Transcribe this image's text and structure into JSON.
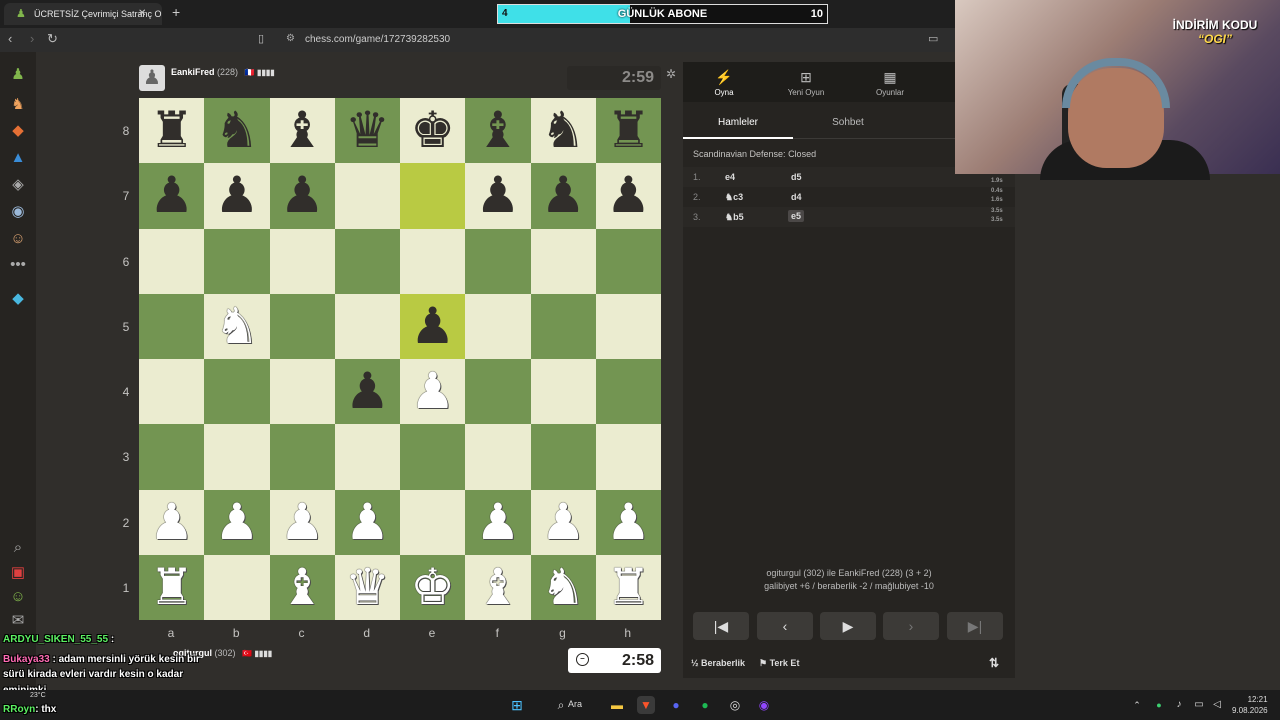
{
  "browser": {
    "tab_title": "ÜCRETSİZ Çevrimiçi Satranç O",
    "url": "chess.com/game/172739282530"
  },
  "sub_goal": {
    "current": "4",
    "label": "GÜNLÜK ABONE",
    "goal": "10",
    "progress_fraction": 0.4,
    "fill_color": "#3fe0e8"
  },
  "promo": {
    "line1": "İNDİRİM KODU",
    "line2": "“OGI”"
  },
  "top_player": {
    "name": "EankiFred",
    "rating": "(228)",
    "flag": "🇫🇷",
    "clock": "2:59"
  },
  "bottom_player": {
    "name": "ogiturgul",
    "rating": "(302)",
    "flag": "🇹🇷",
    "clock": "2:58"
  },
  "board": {
    "ranks": [
      "8",
      "7",
      "6",
      "5",
      "4",
      "3",
      "2",
      "1"
    ],
    "files": [
      "a",
      "b",
      "c",
      "d",
      "e",
      "f",
      "g",
      "h"
    ],
    "highlights": [
      "e7",
      "e5"
    ],
    "pieces": {
      "a8": "br",
      "b8": "bn",
      "c8": "bb",
      "d8": "bq",
      "e8": "bk",
      "f8": "bb",
      "g8": "bn",
      "h8": "br",
      "a7": "bp",
      "b7": "bp",
      "c7": "bp",
      "f7": "bp",
      "g7": "bp",
      "h7": "bp",
      "b5": "wn",
      "e5": "bp",
      "d4": "bp",
      "e4": "wp",
      "a2": "wp",
      "b2": "wp",
      "c2": "wp",
      "d2": "wp",
      "f2": "wp",
      "g2": "wp",
      "h2": "wp",
      "a1": "wr",
      "c1": "wb",
      "d1": "wq",
      "e1": "wk",
      "f1": "wb",
      "g1": "wn",
      "h1": "wr"
    },
    "light_color": "#ebecd0",
    "dark_color": "#739552"
  },
  "panel": {
    "tabs": [
      {
        "label": "Oyna",
        "icon": "⚡"
      },
      {
        "label": "Yeni Oyun",
        "icon": "⊞"
      },
      {
        "label": "Oyunlar",
        "icon": "▦"
      }
    ],
    "subtabs": [
      "Hamleler",
      "Sohbet"
    ],
    "opening": "Scandinavian Defense: Closed",
    "moves": [
      {
        "num": "1.",
        "white": "e4",
        "black": "d5",
        "white_time": "",
        "black_time": "1.9s"
      },
      {
        "num": "2.",
        "white": "♞c3",
        "black": "d4",
        "white_time": "0.4s",
        "black_time": "1.6s"
      },
      {
        "num": "3.",
        "white": "♞b5",
        "black": "e5",
        "white_time": "3.5s",
        "black_time": "3.5s"
      }
    ],
    "game_info_players": "ogiturgul (302) ile EankiFred (228) (3 + 2)",
    "game_info_score": "galibiyet +6 / beraberlik -2 / mağlubiyet -10",
    "draw_label": "Beraberlik",
    "resign_label": "Terk Et"
  },
  "chat": [
    {
      "user": "ARDYU_SIKEN_55_55",
      "sep": " :",
      "text": ""
    },
    {
      "user": "Bukaya33",
      "sep": " :",
      "text": " adam mersinli yörük kesin bir"
    },
    {
      "user": "",
      "sep": "",
      "text": "sürü kirada evleri vardır kesin o kadar"
    },
    {
      "user": "",
      "sep": "",
      "text": "eminimki"
    },
    {
      "user": "RRoyn",
      "sep": ":",
      "text": " thx"
    }
  ],
  "taskbar": {
    "search_label": "Ara",
    "time": "12:21",
    "date": "9.08.2026",
    "weather": "23°C"
  }
}
